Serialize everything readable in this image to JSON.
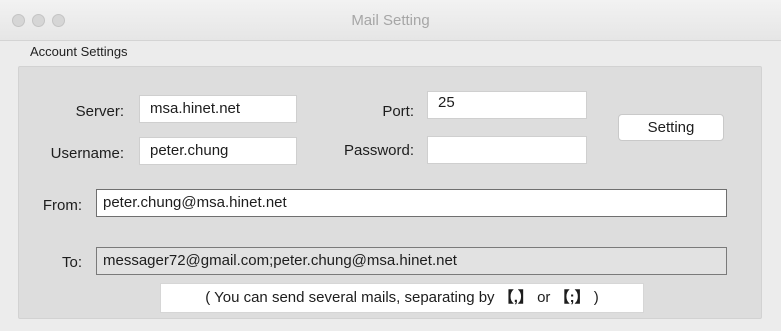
{
  "window": {
    "title": "Mail Setting"
  },
  "account_settings": {
    "section_label": "Account Settings",
    "server": {
      "label": "Server:",
      "value": "msa.hinet.net"
    },
    "port": {
      "label": "Port:",
      "value": "25"
    },
    "username": {
      "label": "Username:",
      "value": "peter.chung"
    },
    "password": {
      "label": "Password:",
      "value": ""
    },
    "setting_button": "Setting",
    "from": {
      "label": "From:",
      "value": "peter.chung@msa.hinet.net"
    },
    "to": {
      "label": "To:",
      "value": "messager72@gmail.com;peter.chung@msa.hinet.net"
    },
    "note": {
      "prefix": "( You can send several mails, separating by ",
      "sep1": "【,】",
      "middle": " or ",
      "sep2": "【;】",
      "suffix": " )"
    }
  },
  "colors": {
    "window_bg": "#ececec",
    "group_bg": "#dddddd",
    "title_text": "#a6a6a6"
  }
}
